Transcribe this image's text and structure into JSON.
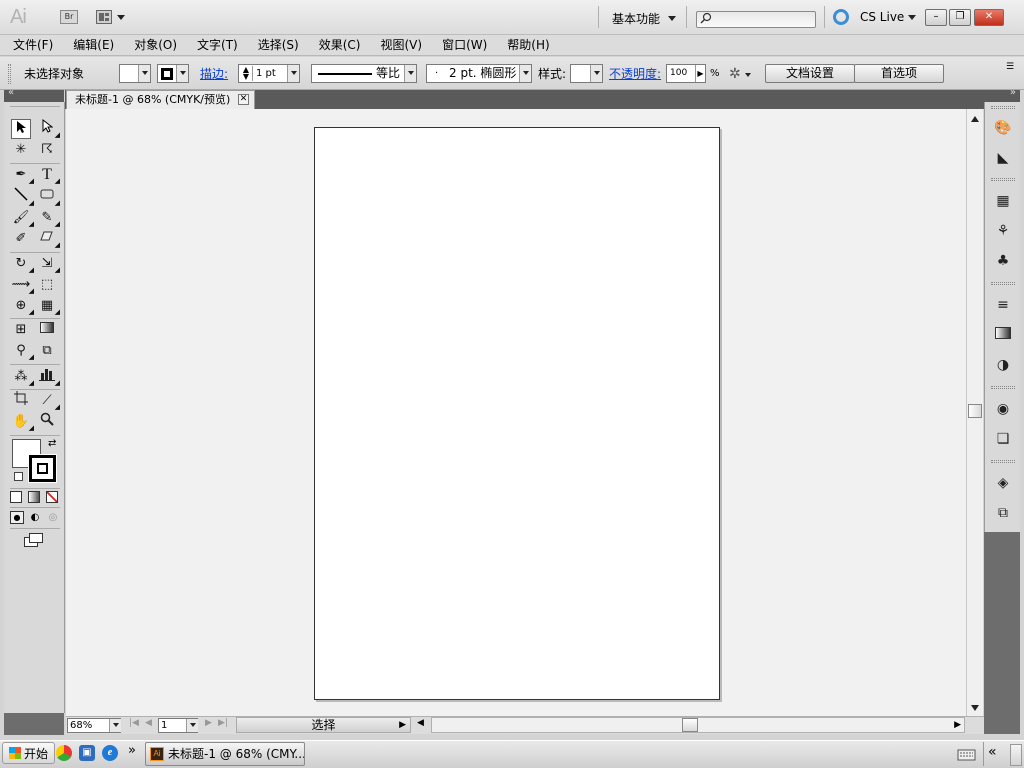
{
  "titlebar": {
    "app_logo": "Ai",
    "bridge_label": "Br",
    "workspace": "基本功能",
    "search_placeholder": "",
    "cslive": "CS Live",
    "min": "–",
    "max": "❐",
    "close": "✕"
  },
  "menu": [
    "文件(F)",
    "编辑(E)",
    "对象(O)",
    "文字(T)",
    "选择(S)",
    "效果(C)",
    "视图(V)",
    "窗口(W)",
    "帮助(H)"
  ],
  "control": {
    "selection_status": "未选择对象",
    "stroke_label": "描边:",
    "stroke_weight": "1 pt",
    "stroke_profile": "等比",
    "brush": "2 pt. 椭圆形",
    "style_label": "样式:",
    "opacity_label": "不透明度:",
    "opacity_value": "100",
    "opacity_unit": "%",
    "doc_setup": "文档设置",
    "preferences": "首选项"
  },
  "document": {
    "tab_title": "未标题-1 @ 68% (CMYK/预览)",
    "zoom": "68%",
    "page": "1",
    "status": "选择"
  },
  "taskbar": {
    "start": "开始",
    "task_label": "未标题-1 @ 68% (CMY...",
    "task_icon": "Ai",
    "chevron": "»",
    "tray_collapse": "«"
  },
  "colors": {
    "accent_link": "#0b3fd1",
    "close_button": "#c0301c",
    "cslive": "#3a8ed6"
  }
}
